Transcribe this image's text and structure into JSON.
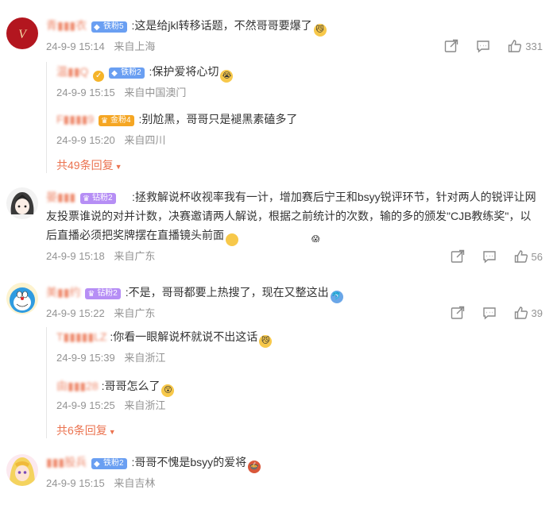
{
  "comments": [
    {
      "name": "青▮▮▮衣",
      "badge": "铁粉5",
      "text": ":这是给jkl转移话题，不然哥哥要爆了",
      "time": "24-9-9 15:14",
      "location": "来自上海",
      "likes": "331",
      "replies": [
        {
          "name": "温▮▮Q",
          "badge": "铁粉2",
          "text": ":保护爱将心切",
          "time": "24-9-9 15:15",
          "location": "来自中国澳门"
        },
        {
          "name": "F▮▮▮▮9",
          "badge": "金粉4",
          "text": ":别尬黑，哥哥只是褪黑素磕多了",
          "time": "24-9-9 15:20",
          "location": "来自四川"
        }
      ],
      "more_replies": "共49条回复"
    },
    {
      "name": "晏▮▮▮",
      "badge": "钻粉2",
      "text": ":拯救解说杯收视率我有一计，增加赛后宁王和bsyy锐评环节，针对两人的锐评让网友投票谁说的对并计数，决赛邀请两人解说，根据之前统计的次数，输的多的颁发\"CJB教练奖\"，以后直播必须把奖牌摆在直播镜头前面",
      "time": "24-9-9 15:18",
      "location": "来自广东",
      "likes": "56"
    },
    {
      "name": "美▮▮约",
      "badge": "钻粉2",
      "text": ":不是，哥哥都要上热搜了，现在又整这出",
      "time": "24-9-9 15:22",
      "location": "来自广东",
      "likes": "39",
      "replies": [
        {
          "name": "T▮▮▮▮▮LZ",
          "text": ":你看一眼解说杯就说不出这话",
          "time": "24-9-9 15:39",
          "location": "来自浙江"
        },
        {
          "name": "由▮▮▮28",
          "text": ":哥哥怎么了",
          "time": "24-9-9 15:25",
          "location": "来自浙江"
        }
      ],
      "more_replies": "共6条回复"
    },
    {
      "name": "▮▮▮股兵",
      "badge": "铁粉2",
      "text": ":哥哥不愧是bsyy的爱将",
      "time": "24-9-9 15:15",
      "location": "来自吉林"
    }
  ],
  "icons": {
    "share": "share-icon",
    "comment": "comment-icon",
    "like": "thumbs-up-icon",
    "chevron": "chevron-down-icon"
  },
  "colors": {
    "username": "#eb7350",
    "meta": "#939393",
    "badge_blue": "#6a9ff2",
    "badge_purple": "#b68ef5",
    "badge_gold": "#f5a623"
  }
}
